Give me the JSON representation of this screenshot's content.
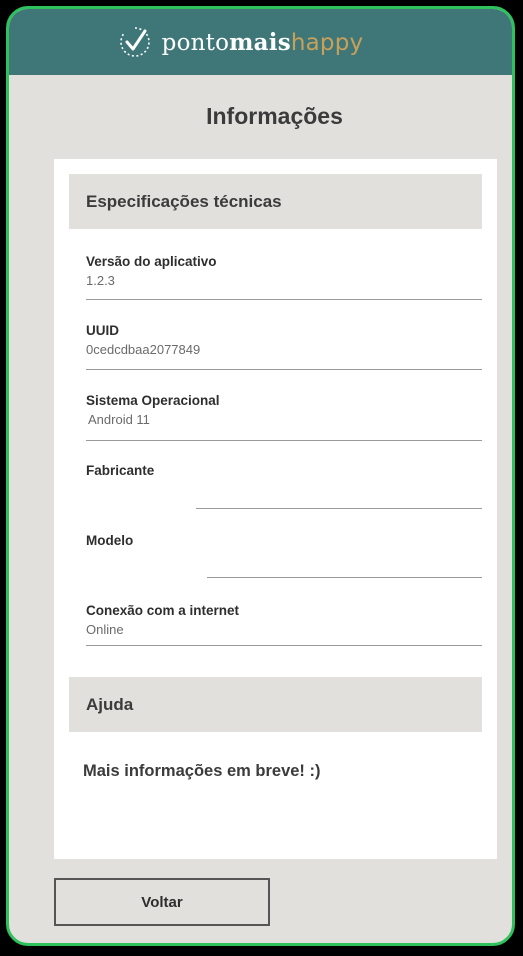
{
  "header": {
    "brand_part1": "ponto",
    "brand_part2": "mais",
    "brand_part3": "happy",
    "logo_icon": "check-circle-icon",
    "bg_color": "#3f7778",
    "accent_color": "#c7a15b"
  },
  "page": {
    "title": "Informações"
  },
  "tech_specs": {
    "heading": "Especificações técnicas",
    "fields": [
      {
        "label": "Versão do aplicativo",
        "value": "1.2.3"
      },
      {
        "label": "UUID",
        "value": "0cedcdbaa2077849"
      },
      {
        "label": "Sistema Operacional",
        "value": "Android 11"
      },
      {
        "label": "Fabricante",
        "value": ""
      },
      {
        "label": "Modelo",
        "value": ""
      },
      {
        "label": "Conexão com a internet",
        "value": "Online"
      }
    ]
  },
  "help": {
    "heading": "Ajuda",
    "text": "Mais informações em breve! :)"
  },
  "actions": {
    "back_label": "Voltar"
  }
}
